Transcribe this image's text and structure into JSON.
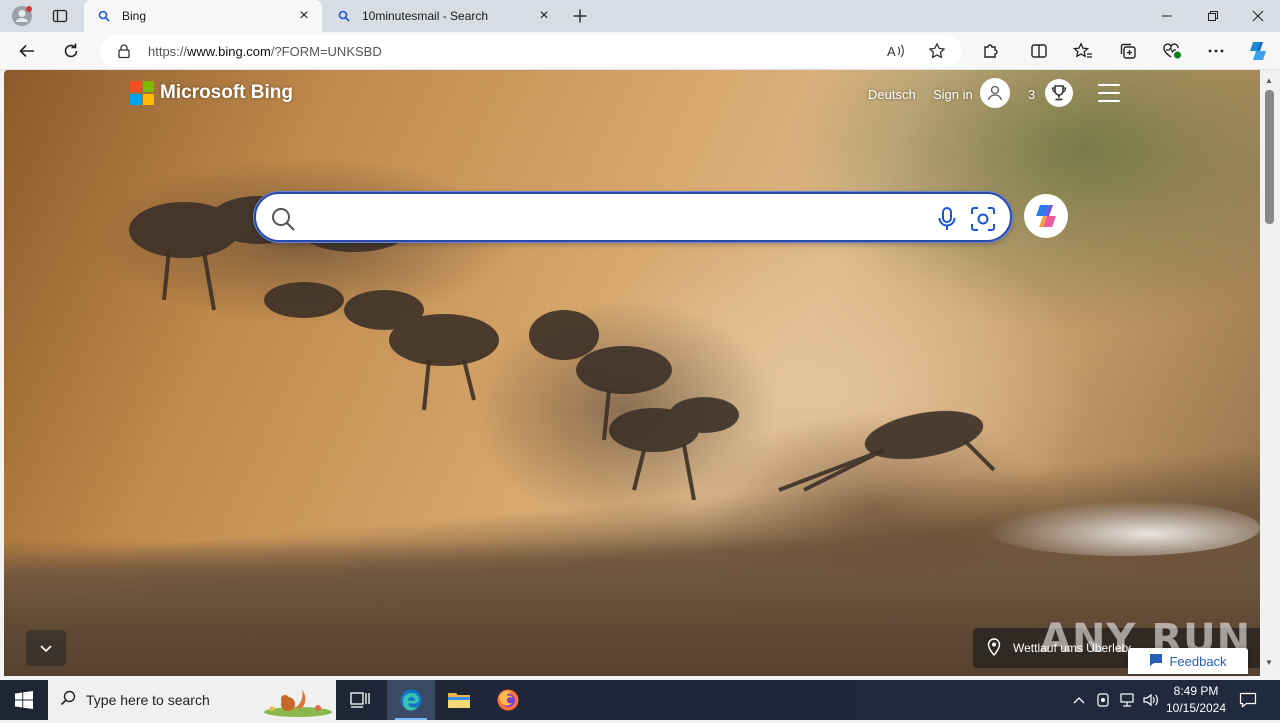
{
  "browser": {
    "tabs": [
      {
        "title": "Bing",
        "active": true
      },
      {
        "title": "10minutesmail - Search",
        "active": false
      }
    ],
    "address": {
      "prefix": "https://",
      "host": "www.bing.com",
      "path": "/?FORM=UNKSBD"
    }
  },
  "bing": {
    "brand": "Microsoft Bing",
    "language_link": "Deutsch",
    "sign_in": "Sign in",
    "rewards_points": "3",
    "search": {
      "value": "",
      "placeholder": ""
    },
    "image_caption": "Wettlauf ums Überleben",
    "feedback": "Feedback",
    "watermark": "ANY RUN"
  },
  "taskbar": {
    "search_placeholder": "Type here to search",
    "time": "8:49 PM",
    "date": "10/15/2024"
  },
  "colors": {
    "accent": "#2a4aa8",
    "taskbar": "#1c2433",
    "tab_strip": "#d8dde3"
  }
}
